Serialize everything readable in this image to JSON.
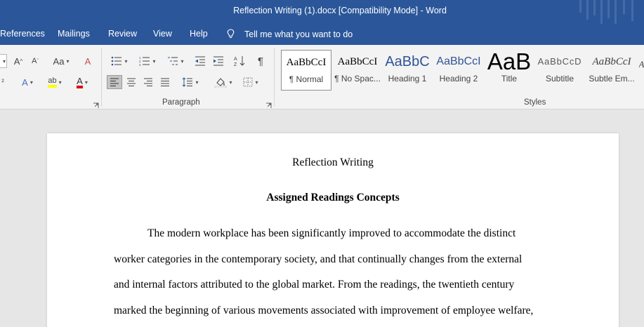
{
  "window": {
    "title": "Reflection Writing (1).docx [Compatibility Mode]  -  Word"
  },
  "ribbon_tabs": [
    "References",
    "Mailings",
    "Review",
    "View",
    "Help"
  ],
  "tell_me": "Tell me what you want to do",
  "groups": {
    "paragraph": "Paragraph",
    "styles": "Styles"
  },
  "styles": [
    {
      "sample": "AaBbCcI",
      "name": "¶ Normal",
      "color": "#000000"
    },
    {
      "sample": "AaBbCcI",
      "name": "¶ No Spac...",
      "color": "#000000"
    },
    {
      "sample": "AaBbC",
      "name": "Heading 1",
      "color": "#2f5496"
    },
    {
      "sample": "AaBbCcI",
      "name": "Heading 2",
      "color": "#2f5496"
    },
    {
      "sample": "AaB",
      "name": "Title",
      "color": "#000000"
    },
    {
      "sample": "AaBbCcD",
      "name": "Subtitle",
      "color": "#595959"
    },
    {
      "sample": "AaBbCcI",
      "name": "Subtle Em...",
      "color": "#404040"
    }
  ],
  "document": {
    "title": "Reflection Writing",
    "heading": "Assigned Readings Concepts",
    "lines": [
      "The modern workplace has been significantly improved to accommodate the distinct",
      "worker categories in the contemporary society, and that continually changes from the external",
      "and internal factors attributed to the global market. From the readings, the twentieth century",
      "marked the beginning of various movements associated with improvement of employee welfare,"
    ]
  },
  "colors": {
    "accent": "#2b579a",
    "ribbon": "#f3f3f3",
    "canvas": "#e6e6e6"
  }
}
